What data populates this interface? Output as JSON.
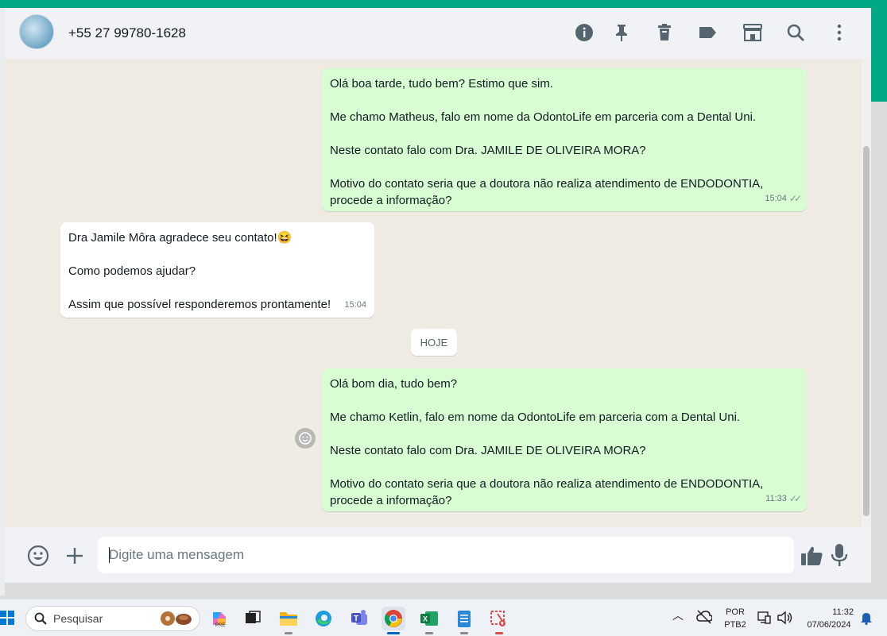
{
  "header": {
    "contact_name": "+55 27 99780-1628",
    "icons": [
      "info-icon",
      "pin-icon",
      "delete-icon",
      "label-icon",
      "catalog-icon",
      "search-icon",
      "menu-icon"
    ]
  },
  "messages": [
    {
      "direction": "out",
      "text": "Olá boa tarde, tudo bem? Estimo que sim.\n\nMe chamo Matheus, falo em nome da OdontoLife em parceria com a Dental Uni.\n\nNeste contato falo com Dra. JAMILE DE OLIVEIRA MORA?\n\nMotivo do contato seria que a doutora não realiza atendimento de ENDODONTIA,\nprocede a informação?",
      "time": "15:04",
      "status": "read"
    },
    {
      "direction": "in",
      "text": "Dra Jamile Môra agradece seu contato!😆\n\nComo podemos ajudar?\n\nAssim que possível responderemos prontamente!",
      "time": "15:04"
    },
    {
      "direction": "out",
      "text": "Olá bom dia, tudo bem?\n\nMe chamo Ketlin, falo em nome da OdontoLife em parceria com a Dental Uni.\n\nNeste contato falo com Dra. JAMILE DE OLIVEIRA MORA?\n\nMotivo do contato seria que a doutora não realiza atendimento de ENDODONTIA,\nprocede a informação?",
      "time": "11:33",
      "status": "read"
    }
  ],
  "date_divider": "HOJE",
  "composer": {
    "placeholder": "Digite uma mensagem"
  },
  "taskbar": {
    "search_placeholder": "Pesquisar",
    "language": "POR",
    "keyboard": "PTB2",
    "time": "11:32",
    "date": "07/06/2024"
  },
  "colors": {
    "accent": "#00a884",
    "outgoing_bubble": "#d9fdd3",
    "incoming_bubble": "#ffffff",
    "chat_bg": "#efeae2"
  }
}
